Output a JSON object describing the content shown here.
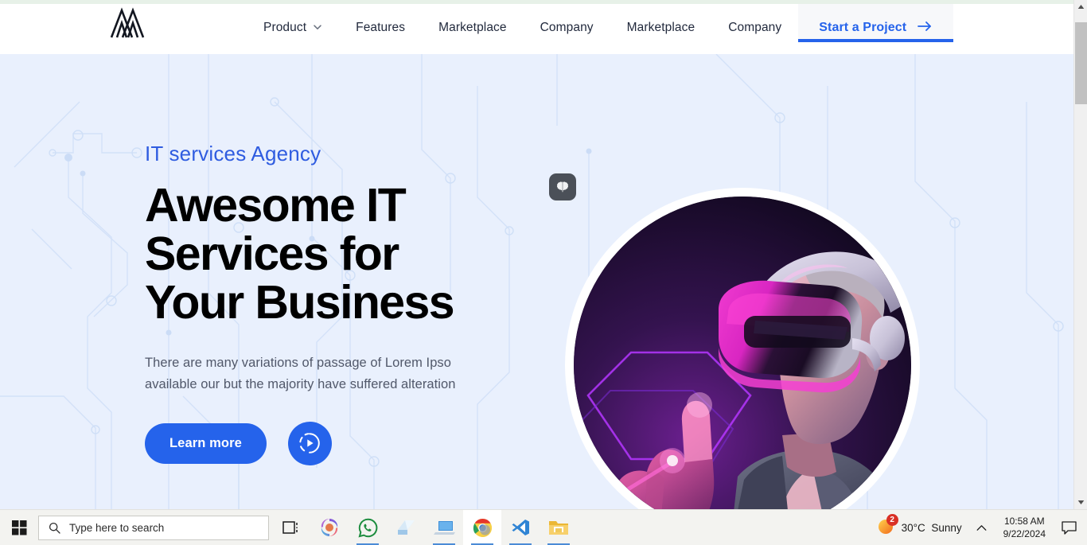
{
  "browser": {
    "scrollbar": {
      "up_arrow_icon": "scroll-up-arrow-icon",
      "down_arrow_icon": "scroll-down-arrow-icon"
    }
  },
  "site": {
    "logo_icon": "brand-logo-icon",
    "nav": {
      "items": [
        {
          "label": "Product",
          "has_dropdown": true,
          "icon": "chevron-down-icon"
        },
        {
          "label": "Features",
          "has_dropdown": false
        },
        {
          "label": "Marketplace",
          "has_dropdown": false
        },
        {
          "label": "Company",
          "has_dropdown": false
        },
        {
          "label": "Marketplace",
          "has_dropdown": false
        },
        {
          "label": "Company",
          "has_dropdown": false
        }
      ],
      "cta": {
        "label": "Start a Project",
        "icon": "arrow-right-icon",
        "accent_color": "#2563eb"
      }
    }
  },
  "hero": {
    "eyebrow": "IT services Agency",
    "title_lines": [
      "Awesome IT",
      "Services for",
      "Your Business"
    ],
    "subtitle_lines": [
      "There are many variations of passage of Lorem Ipso",
      "available our but the majority have suffered alteration"
    ],
    "primary_button": {
      "label": "Learn more",
      "color": "#2563eb"
    },
    "play_button": {
      "icon": "play-circle-icon",
      "color": "#2563eb"
    },
    "badge": {
      "icon": "brain-icon",
      "color": "#4b5058"
    },
    "image": {
      "alt": "man wearing a VR headset pointing at a glowing hexagon",
      "icon": "vr-headset-photo"
    },
    "background_color": "#e9f0fd",
    "pattern": "circuit-board-traces"
  },
  "taskbar": {
    "start_icon": "windows-start-icon",
    "search": {
      "icon": "search-icon",
      "placeholder": "Type here to search"
    },
    "items": [
      {
        "name": "task-view",
        "icon": "task-view-icon",
        "running": false,
        "active": false
      },
      {
        "name": "copilot",
        "icon": "copilot-icon",
        "running": false,
        "active": false
      },
      {
        "name": "whatsapp",
        "icon": "whatsapp-icon",
        "running": true,
        "active": false
      },
      {
        "name": "sticky-notes",
        "icon": "sticky-notes-icon",
        "running": false,
        "active": false
      },
      {
        "name": "remote-desktop",
        "icon": "remote-desktop-icon",
        "running": true,
        "active": false
      },
      {
        "name": "google-chrome",
        "icon": "chrome-icon",
        "running": true,
        "active": true
      },
      {
        "name": "visual-studio-code",
        "icon": "vscode-icon",
        "running": true,
        "active": false
      },
      {
        "name": "file-explorer",
        "icon": "file-explorer-icon",
        "running": true,
        "active": false
      }
    ],
    "tray": {
      "weather": {
        "icon": "sun-icon",
        "badge": "2",
        "temperature": "30°C",
        "condition": "Sunny"
      },
      "chevron_icon": "chevron-up-icon",
      "time": "10:58 AM",
      "date": "9/22/2024",
      "notification_icon": "notification-chat-icon"
    }
  }
}
